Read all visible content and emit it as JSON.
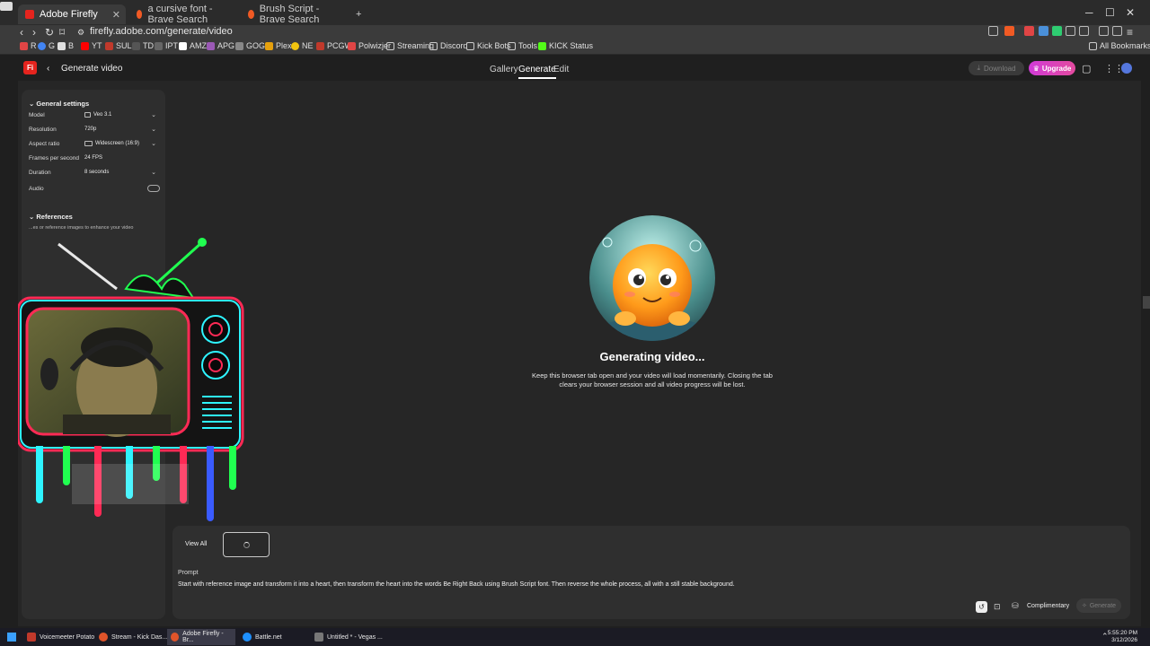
{
  "browser": {
    "tabs": [
      {
        "title": "Adobe Firefly",
        "active": true
      },
      {
        "title": "a cursive font - Brave Search",
        "active": false
      },
      {
        "title": "Brush Script - Brave Search",
        "active": false
      }
    ],
    "new_tab": "+",
    "url": "firefly.adobe.com/generate/video",
    "bookmarks": [
      "R",
      "G",
      "B",
      "YT",
      "SUL",
      "TD",
      "IPT",
      "AMZ",
      "APG",
      "GOG",
      "Plex",
      "NE",
      "PCGW",
      "Polwizjer",
      "Streaming",
      "Discord",
      "Kick Bots",
      "Tools",
      "KICK Status"
    ],
    "all_bookmarks": "All Bookmarks"
  },
  "app": {
    "logo": "Fi",
    "page_title": "Generate video",
    "nav": [
      {
        "label": "Gallery",
        "active": false
      },
      {
        "label": "Generate",
        "active": true
      },
      {
        "label": "Edit",
        "active": false
      }
    ],
    "download_label": "Download",
    "upgrade_label": "Upgrade"
  },
  "settings": {
    "section_title": "General settings",
    "model_label": "Model",
    "model_value": "Veo 3.1",
    "resolution_label": "Resolution",
    "resolution_value": "720p",
    "aspect_label": "Aspect ratio",
    "aspect_value": "Widescreen (16:9)",
    "fps_label": "Frames per second",
    "fps_value": "24 FPS",
    "duration_label": "Duration",
    "duration_value": "8 seconds",
    "audio_label": "Audio",
    "references_title": "References",
    "references_hint": "...es or reference images to enhance your video"
  },
  "generation": {
    "title": "Generating video...",
    "message_line1": "Keep this browser tab open and your video will load momentarily. Closing the tab",
    "message_line2": "clears your browser session and all video progress will be lost."
  },
  "prompt": {
    "view_all": "View All",
    "label": "Prompt",
    "text": "Start with reference image and transform it into a heart, then transform the heart into the words Be Right Back using Brush Script font. Then reverse the whole process, all with a still stable background.",
    "credits_label": "Complimentary",
    "generate_label": "Generate"
  },
  "taskbar": {
    "items": [
      {
        "label": "Voicemeeter Potato",
        "color": "#c0392b"
      },
      {
        "label": "Stream - Kick Das...",
        "color": "#e0542a"
      },
      {
        "label": "Adobe Firefly - Br...",
        "color": "#e0542a"
      },
      {
        "label": "Battle.net",
        "color": "#1e90ff"
      },
      {
        "label": "Untitled * - Vegas ...",
        "color": "#777777"
      }
    ],
    "time": "5:55:20 PM",
    "date": "3/12/2026"
  },
  "colors": {
    "accent": "#e5241e",
    "upgrade": "#d13bd8",
    "background": "#262626"
  }
}
